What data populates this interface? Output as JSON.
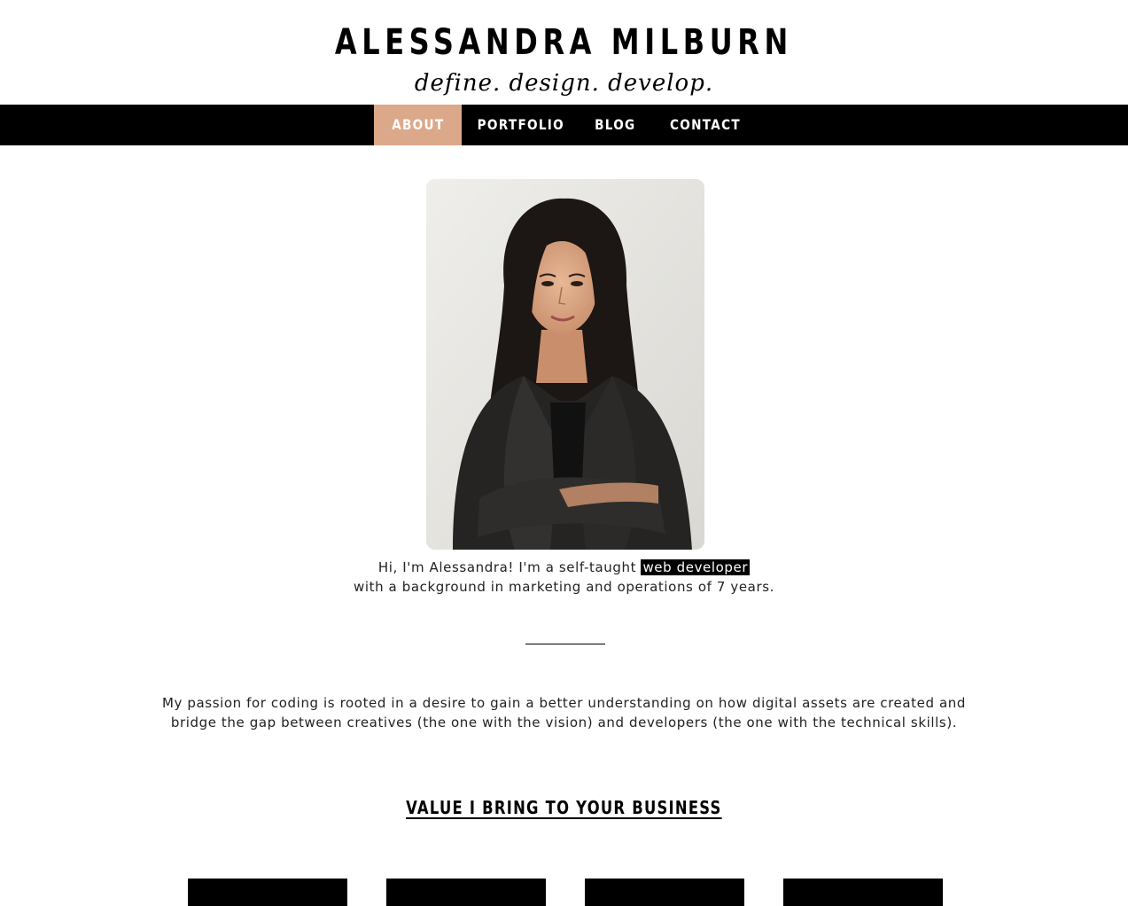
{
  "header": {
    "site_title": "ALESSANDRA MILBURN",
    "tagline": "define. design. develop."
  },
  "nav": {
    "items": [
      {
        "label": "ABOUT",
        "active": true
      },
      {
        "label": "PORTFOLIO",
        "active": false
      },
      {
        "label": "BLOG",
        "active": false
      },
      {
        "label": "CONTACT",
        "active": false
      }
    ],
    "background_color": "#000000",
    "active_color": "#dba88a"
  },
  "about": {
    "photo_icon": "profile-photo",
    "intro_before": "Hi, I'm Alessandra! I'm a self-taught",
    "intro_highlight": "web developer",
    "intro_line2": "with a background in marketing and operations of 7 years.",
    "passion_text": "My passion for coding is rooted in a desire to gain a better understanding on how digital assets are created and bridge the gap between creatives (the one with the vision) and developers (the one with the technical skills).",
    "value_heading": "VALUE I BRING TO YOUR BUSINESS"
  }
}
